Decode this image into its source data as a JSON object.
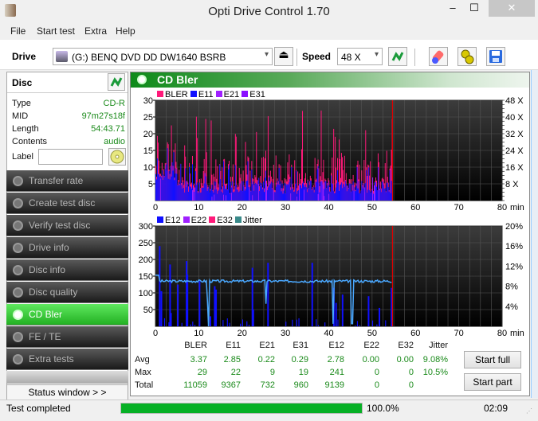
{
  "window": {
    "title": "Opti Drive Control 1.70",
    "min": "‒",
    "max": "☐",
    "close": "✕"
  },
  "menu": [
    "File",
    "Start test",
    "Extra",
    "Help"
  ],
  "toolbar": {
    "drive_label": "Drive",
    "drive_value": "(G:)  BENQ DVD DD DW1640 BSRB",
    "speed_label": "Speed",
    "speed_value": "48 X",
    "eject_icon": "⏏"
  },
  "disc": {
    "title": "Disc",
    "fields": [
      {
        "label": "Type",
        "value": "CD-R"
      },
      {
        "label": "MID",
        "value": "97m27s18f"
      },
      {
        "label": "Length",
        "value": "54:43.71"
      },
      {
        "label": "Contents",
        "value": "audio"
      }
    ],
    "label_field_label": "Label",
    "label_value": ""
  },
  "nav": [
    {
      "label": "Transfer rate",
      "active": false
    },
    {
      "label": "Create test disc",
      "active": false
    },
    {
      "label": "Verify test disc",
      "active": false
    },
    {
      "label": "Drive info",
      "active": false
    },
    {
      "label": "Disc info",
      "active": false
    },
    {
      "label": "Disc quality",
      "active": false
    },
    {
      "label": "CD Bler",
      "active": true
    },
    {
      "label": "FE / TE",
      "active": false
    },
    {
      "label": "Extra tests",
      "active": false
    }
  ],
  "status_window_label": "Status window > >",
  "panel": {
    "title": "CD Bler"
  },
  "chart_data": [
    {
      "type": "bar",
      "title": "BLER / E11 / E21 / E31",
      "legend": [
        {
          "name": "BLER",
          "color": "#ff1a7a"
        },
        {
          "name": "E11",
          "color": "#1010ff"
        },
        {
          "name": "E21",
          "color": "#a020ff"
        },
        {
          "name": "E31",
          "color": "#8a10ff"
        }
      ],
      "xlabel": "min",
      "xlim": [
        0,
        80
      ],
      "xticks": [
        "0",
        "10",
        "20",
        "30",
        "40",
        "50",
        "60",
        "70",
        "80"
      ],
      "ylim": [
        0,
        30
      ],
      "yticks": [
        "5",
        "10",
        "15",
        "20",
        "25",
        "30"
      ],
      "y2ticks": [
        "8 X",
        "16 X",
        "24 X",
        "32 X",
        "40 X",
        "48 X"
      ],
      "y2lim": [
        0,
        48
      ],
      "end_marker_min": 54.7,
      "series_summary": {
        "BLER_max": 29,
        "E11_max": 22,
        "E21_max": 9,
        "E31_max": 19
      },
      "grid": true
    },
    {
      "type": "bar",
      "title": "E12 / E22 / E32 / Jitter",
      "legend": [
        {
          "name": "E12",
          "color": "#1010ff"
        },
        {
          "name": "E22",
          "color": "#a020ff"
        },
        {
          "name": "E32",
          "color": "#ff1a7a"
        },
        {
          "name": "Jitter",
          "color": "#3a8a8a"
        }
      ],
      "xlabel": "min",
      "xlim": [
        0,
        80
      ],
      "xticks": [
        "0",
        "10",
        "20",
        "30",
        "40",
        "50",
        "60",
        "70",
        "80"
      ],
      "ylim": [
        0,
        300
      ],
      "yticks": [
        "50",
        "100",
        "150",
        "200",
        "250",
        "300"
      ],
      "y2ticks": [
        "4%",
        "8%",
        "12%",
        "16%",
        "20%"
      ],
      "y2lim": [
        0,
        20
      ],
      "end_marker_min": 54.7,
      "e12_spikes": [
        [
          0.8,
          240
        ],
        [
          1.2,
          105
        ],
        [
          3.2,
          185
        ],
        [
          3.4,
          40
        ],
        [
          5,
          125
        ],
        [
          7,
          195
        ],
        [
          7.2,
          155
        ],
        [
          10,
          135
        ],
        [
          12.5,
          30
        ],
        [
          13.5,
          120
        ],
        [
          13.8,
          110
        ],
        [
          22.2,
          175
        ],
        [
          22.4,
          50
        ],
        [
          25.8,
          190
        ],
        [
          36,
          190
        ],
        [
          41,
          115
        ],
        [
          41.5,
          70
        ],
        [
          43,
          95
        ],
        [
          49,
          90
        ],
        [
          51.5,
          55
        ],
        [
          54.3,
          115
        ]
      ],
      "jitter_pct": {
        "avg": 9.08,
        "max": 10.5,
        "baseline": 9.0
      },
      "jitter_dips": [
        [
          12,
          5.0
        ],
        [
          25.5,
          4.5
        ],
        [
          41,
          0.5
        ],
        [
          45.4,
          0.5
        ]
      ],
      "grid": true
    }
  ],
  "stats": {
    "columns": [
      "BLER",
      "E11",
      "E21",
      "E31",
      "E12",
      "E22",
      "E32",
      "Jitter"
    ],
    "rows": [
      {
        "label": "Avg",
        "values": [
          "3.37",
          "2.85",
          "0.22",
          "0.29",
          "2.78",
          "0.00",
          "0.00",
          "9.08%"
        ]
      },
      {
        "label": "Max",
        "values": [
          "29",
          "22",
          "9",
          "19",
          "241",
          "0",
          "0",
          "10.5%"
        ]
      },
      {
        "label": "Total",
        "values": [
          "11059",
          "9367",
          "732",
          "960",
          "9139",
          "0",
          "0",
          ""
        ]
      }
    ]
  },
  "buttons": {
    "start_full": "Start full",
    "start_part": "Start part"
  },
  "statusbar": {
    "text": "Test completed",
    "progress": 100.0,
    "progress_label": "100.0%",
    "time": "02:09"
  }
}
